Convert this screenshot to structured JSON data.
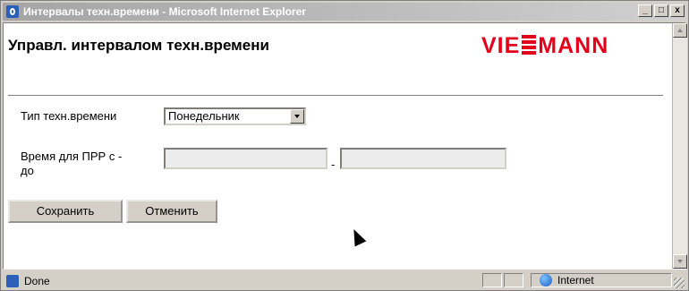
{
  "window": {
    "title": "Интервалы техн.времени - Microsoft Internet Explorer",
    "buttons": {
      "minimize": "_",
      "maximize": "□",
      "close": "x"
    }
  },
  "page": {
    "title": "Управл. интервалом техн.времени",
    "logo": {
      "text_left": "VIE",
      "text_right": "MANN",
      "color": "#e3001b"
    }
  },
  "form": {
    "type_label": "Тип техн.времени",
    "type_value": "Понедельник",
    "range_label_line1": "Время для ПРР с -",
    "range_label_line2": "до",
    "range_separator": "-",
    "from_value": "",
    "to_value": ""
  },
  "buttons": {
    "save": "Сохранить",
    "cancel": "Отменить"
  },
  "status": {
    "text": "Done",
    "zone": "Internet"
  }
}
